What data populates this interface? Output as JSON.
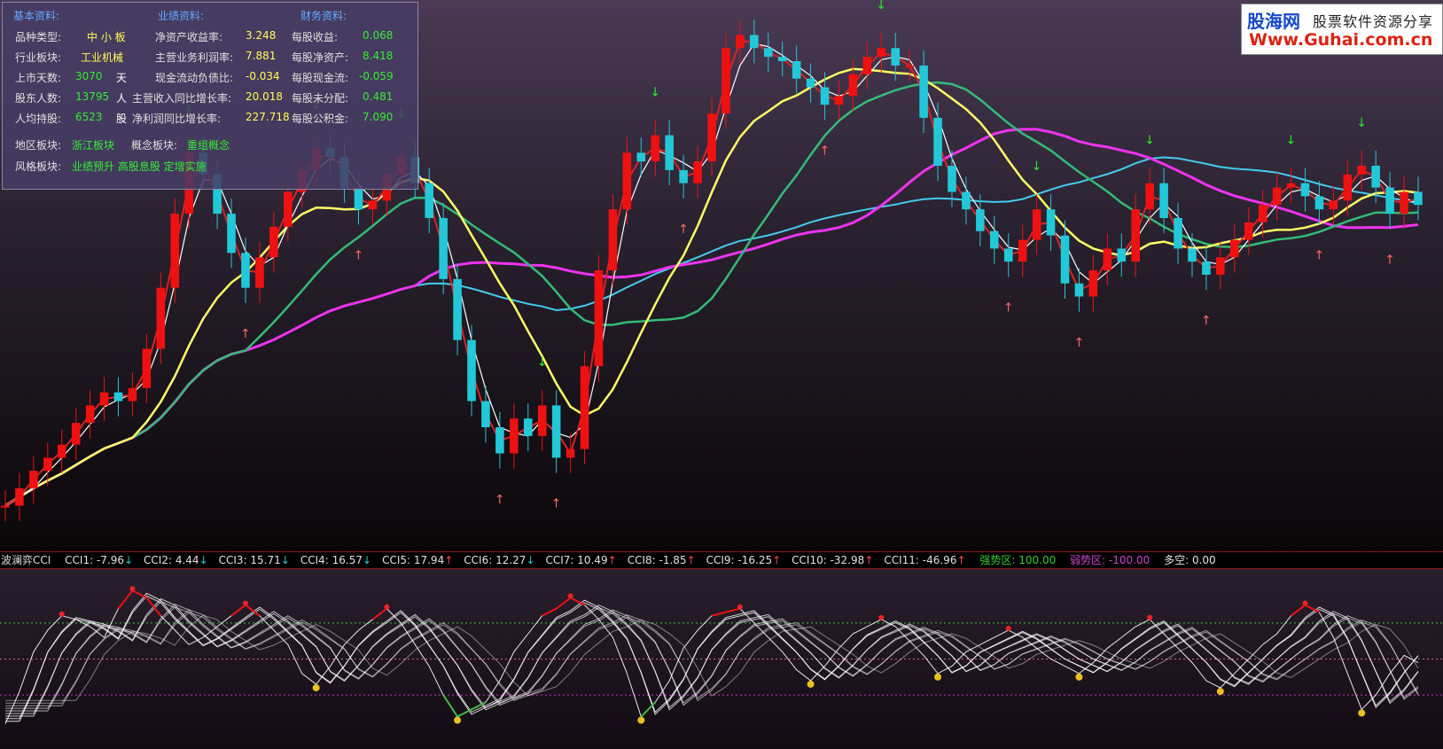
{
  "info": {
    "headers": {
      "basic": "基本资料:",
      "perf": "业绩资料:",
      "fin": "财务资料:"
    },
    "rows": [
      {
        "l1": "品种类型:",
        "v1": "中 小 板",
        "l2": "净资产收益率:",
        "v2": "3.248",
        "l3": "每股收益:",
        "v3": "0.068"
      },
      {
        "l1": "行业板块:",
        "v1": "工业机械",
        "l2": "主营业务利润率:",
        "v2": "7.881",
        "l3": "每股净资产:",
        "v3": "8.418"
      },
      {
        "l1": "上市天数:",
        "v1": "3070",
        "u1": "天",
        "l2": "现金流动负债比:",
        "v2": "-0.034",
        "l3": "每股现金流:",
        "v3": "-0.059"
      },
      {
        "l1": "股东人数:",
        "v1": "13795",
        "u1": "人",
        "l2": "主营收入同比增长率:",
        "v2": "20.018",
        "l3": "每股未分配:",
        "v3": "0.481"
      },
      {
        "l1": "人均持股:",
        "v1": "6523",
        "u1": "股",
        "l2": "净利润同比增长率:",
        "v2": "227.718",
        "l3": "每股公积金:",
        "v3": "7.090"
      }
    ],
    "region_label": "地区板块:",
    "region": "浙江板块",
    "concept_label": "概念板块:",
    "concept": "重组概念",
    "style_label": "风格板块:",
    "style": "业绩预升 高股息股 定增实施"
  },
  "logo": {
    "name": "股海网",
    "slogan": "股票软件资源分享",
    "url": "Www.Guhai.com.cn"
  },
  "indicator": {
    "name": "波澜弈CCI",
    "items": [
      {
        "label": "CCI1: -7.96",
        "dir": "↓"
      },
      {
        "label": "CCI2: 4.44",
        "dir": "↓"
      },
      {
        "label": "CCI3: 15.71",
        "dir": "↓"
      },
      {
        "label": "CCI4: 16.57",
        "dir": "↓"
      },
      {
        "label": "CCI5: 17.94",
        "dir": "↑"
      },
      {
        "label": "CCI6: 12.27",
        "dir": "↓"
      },
      {
        "label": "CCI7: 10.49",
        "dir": "↑"
      },
      {
        "label": "CCI8: -1.85",
        "dir": "↑"
      },
      {
        "label": "CCI9: -16.25",
        "dir": "↑"
      },
      {
        "label": "CCI10: -32.98",
        "dir": "↑"
      },
      {
        "label": "CCI11: -46.96",
        "dir": "↑"
      }
    ],
    "strong_label": "强势区:",
    "strong": "100.00",
    "weak_label": "弱势区:",
    "weak": "-100.00",
    "dk_label": "多空:",
    "dk": "0.00"
  },
  "colors": {
    "up": "#ee1111",
    "down": "#22c8d8",
    "ma_white": "#ffffff",
    "ma_yellow": "#ffff66",
    "ma_green": "#33bb77",
    "ma_magenta": "#ee33ee",
    "ma_cyan": "#44ccee",
    "strong": "#33cc33",
    "weak": "#cc33cc"
  },
  "chart_data": {
    "type": "line",
    "price_series": {
      "name": "",
      "values": [
        10.2,
        10.6,
        11.0,
        11.3,
        11.6,
        12.1,
        12.5,
        12.8,
        12.6,
        12.9,
        13.8,
        15.2,
        16.9,
        18.3,
        17.8,
        16.9,
        16.0,
        15.2,
        15.9,
        16.6,
        17.4,
        17.9,
        18.4,
        18.2,
        17.5,
        17.0,
        17.2,
        17.8,
        18.2,
        17.6,
        16.8,
        15.4,
        14.0,
        12.6,
        12.0,
        11.4,
        12.2,
        11.8,
        12.5,
        11.3,
        11.5,
        13.4,
        15.6,
        17.0,
        18.3,
        18.1,
        18.7,
        17.9,
        17.6,
        18.1,
        19.2,
        20.7,
        21.0,
        20.7,
        20.5,
        20.4,
        20.0,
        19.8,
        19.4,
        19.6,
        20.1,
        20.5,
        20.7,
        20.3,
        20.3,
        19.1,
        18.0,
        17.4,
        17.0,
        16.5,
        16.1,
        15.8,
        16.3,
        17.0,
        16.4,
        15.3,
        15.0,
        15.6,
        16.1,
        15.8,
        17.0,
        17.6,
        16.8,
        16.1,
        15.8,
        15.5,
        15.9,
        16.3,
        16.7,
        17.1,
        17.5,
        17.6,
        17.3,
        17.0,
        17.2,
        17.8,
        18.0,
        17.5,
        16.9,
        17.4,
        17.1
      ]
    },
    "indicator_series": {
      "name": "",
      "values": [
        -180,
        -90,
        20,
        80,
        120,
        110,
        90,
        60,
        140,
        190,
        170,
        120,
        80,
        40,
        60,
        90,
        120,
        150,
        120,
        80,
        40,
        -40,
        -70,
        -20,
        40,
        80,
        110,
        140,
        100,
        40,
        -20,
        -100,
        -160,
        -140,
        -120,
        -60,
        20,
        70,
        120,
        140,
        170,
        150,
        110,
        60,
        -40,
        -160,
        -120,
        -60,
        30,
        80,
        120,
        130,
        140,
        100,
        60,
        20,
        -30,
        -60,
        -20,
        30,
        70,
        90,
        110,
        90,
        50,
        10,
        -40,
        -20,
        20,
        40,
        60,
        80,
        60,
        30,
        0,
        -20,
        -40,
        -10,
        30,
        60,
        90,
        110,
        70,
        30,
        -10,
        -60,
        -80,
        -40,
        0,
        40,
        70,
        120,
        150,
        130,
        60,
        -40,
        -140,
        -100,
        -40,
        10,
        -10
      ]
    },
    "strong_zone": 100,
    "weak_zone": -100
  }
}
